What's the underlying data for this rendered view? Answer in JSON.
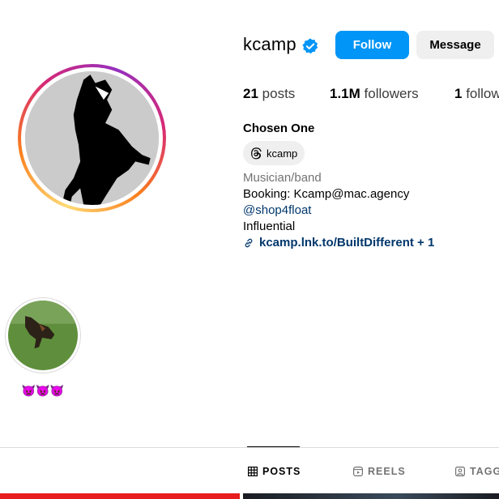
{
  "profile": {
    "username": "kcamp",
    "verified": true,
    "follow_label": "Follow",
    "message_label": "Message",
    "stats": {
      "posts_count": "21",
      "posts_label": "posts",
      "followers_count": "1.1M",
      "followers_label": "followers",
      "following_count": "1",
      "following_label": "following"
    },
    "full_name": "Chosen One",
    "threads_handle": "kcamp",
    "category": "Musician/band",
    "bio_lines": [
      "Booking: Kcamp@mac.agency",
      "@shop4float",
      "Influential"
    ],
    "link": "kcamp.lnk.to/BuiltDifferent + 1"
  },
  "highlights": [
    {
      "label": "👿👿👿"
    }
  ],
  "tabs": [
    {
      "label": "POSTS",
      "active": true,
      "icon": "grid-icon"
    },
    {
      "label": "REELS",
      "active": false,
      "icon": "reels-icon"
    },
    {
      "label": "TAGGED",
      "active": false,
      "icon": "tagged-icon"
    }
  ],
  "colors": {
    "follow_button": "#0095f6",
    "message_button": "#efefef",
    "link_text": "#00376b",
    "verified_badge": "#0095f6",
    "muted_text": "#737373"
  }
}
